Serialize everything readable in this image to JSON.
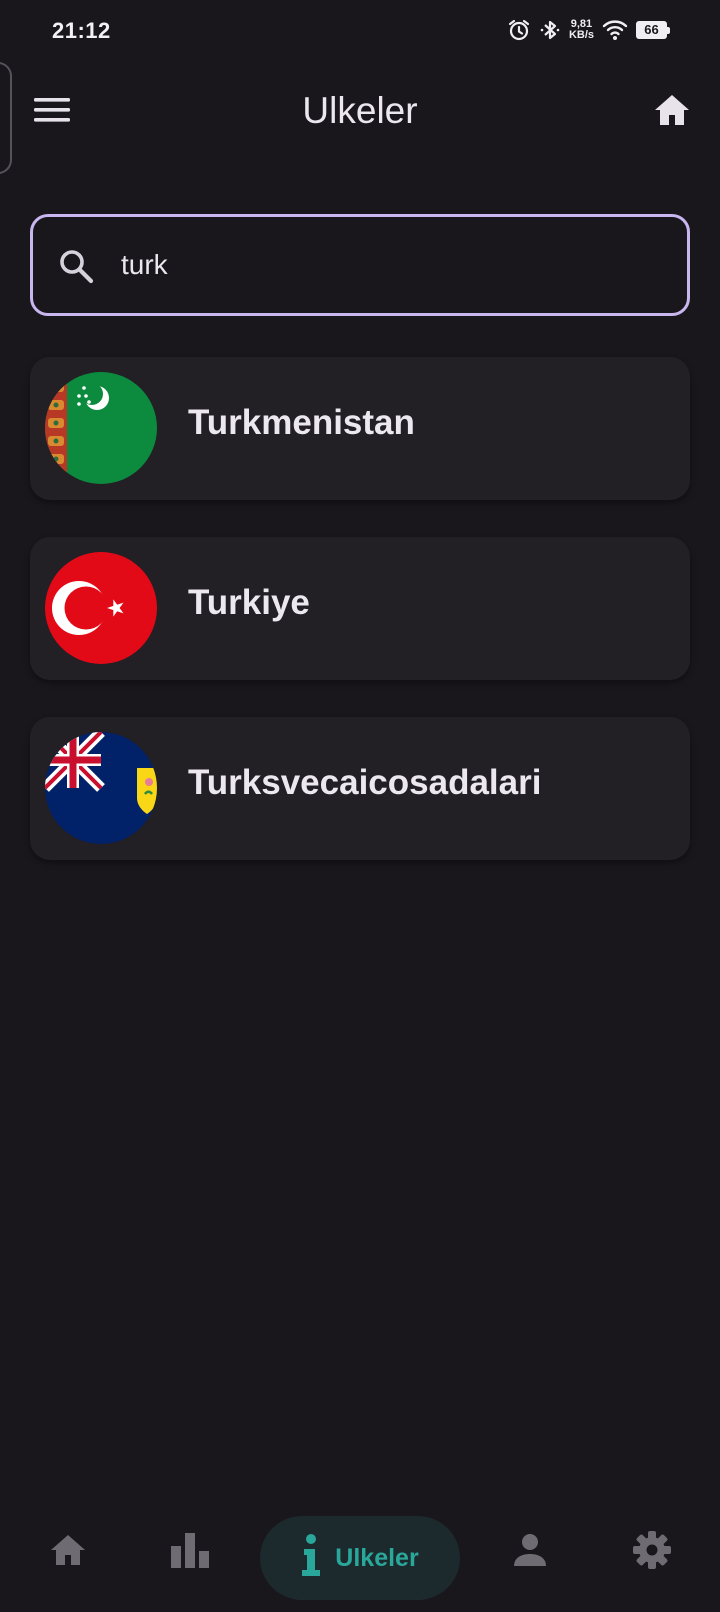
{
  "status_bar": {
    "time": "21:12",
    "net_speed_value": "9,81",
    "net_speed_unit": "KB/s",
    "battery": "66",
    "icons": [
      "alarm-icon",
      "bluetooth-icon",
      "wifi-icon",
      "battery-icon"
    ]
  },
  "app_bar": {
    "title": "Ulkeler",
    "left_icon": "menu-icon",
    "right_icon": "home-icon"
  },
  "search": {
    "value": "turk",
    "icon": "search-icon"
  },
  "countries": [
    {
      "name": "Turkmenistan",
      "flag": "turkmenistan-flag"
    },
    {
      "name": "Turkiye",
      "flag": "turkiye-flag"
    },
    {
      "name": "Turksvecaicosadalari",
      "flag": "turks-and-caicos-flag"
    }
  ],
  "bottom_nav": {
    "items": [
      {
        "icon": "home-icon",
        "label": ""
      },
      {
        "icon": "bar-chart-icon",
        "label": ""
      },
      {
        "icon": "info-icon",
        "label": "Ulkeler",
        "active": true
      },
      {
        "icon": "person-icon",
        "label": ""
      },
      {
        "icon": "gear-icon",
        "label": ""
      }
    ],
    "active_color": "#2aa79b",
    "inactive_color": "#6f6b73"
  },
  "colors": {
    "background": "#19161c",
    "card": "#221f25",
    "search_border": "#c8b6ee"
  }
}
